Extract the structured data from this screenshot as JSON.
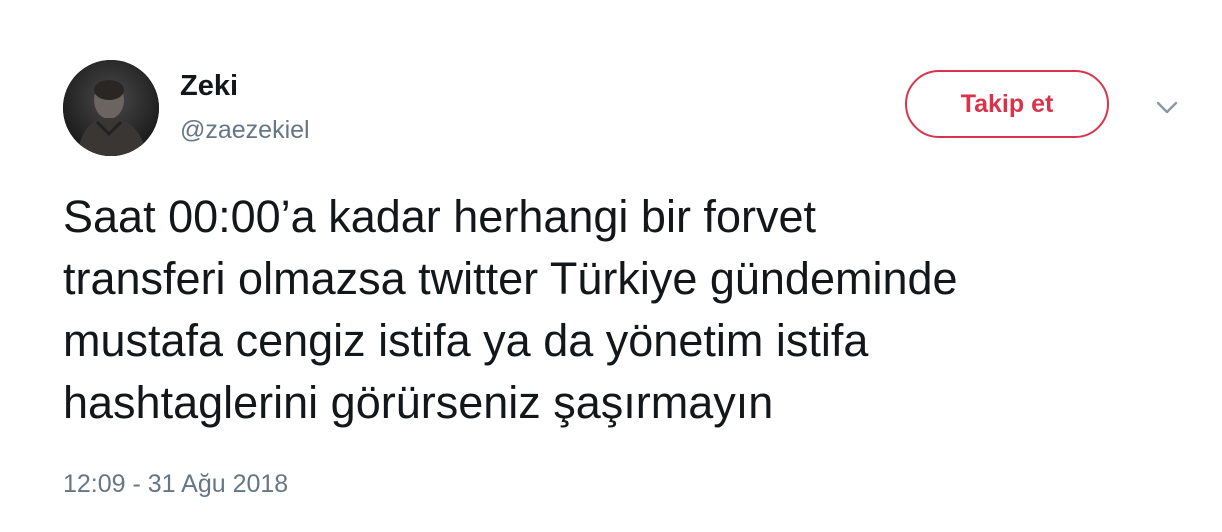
{
  "author": {
    "display_name": "Zeki",
    "username": "@zaezekiel",
    "avatar_icon": "profile-photo"
  },
  "follow_button": {
    "label": "Takip et",
    "color": "#d9334c"
  },
  "menu_icon": "chevron-down-icon",
  "tweet": {
    "lines": [
      "Saat 00:00’a kadar herhangi bir forvet",
      "transferi olmazsa twitter Türkiye gündeminde",
      "mustafa cengiz istifa ya da yönetim istifa",
      "hashtaglerini görürseniz şaşırmayın"
    ],
    "timestamp": "12:09 - 31 Ağu 2018"
  },
  "colors": {
    "text": "#14171a",
    "secondary": "#657786",
    "accent": "#d9334c"
  }
}
